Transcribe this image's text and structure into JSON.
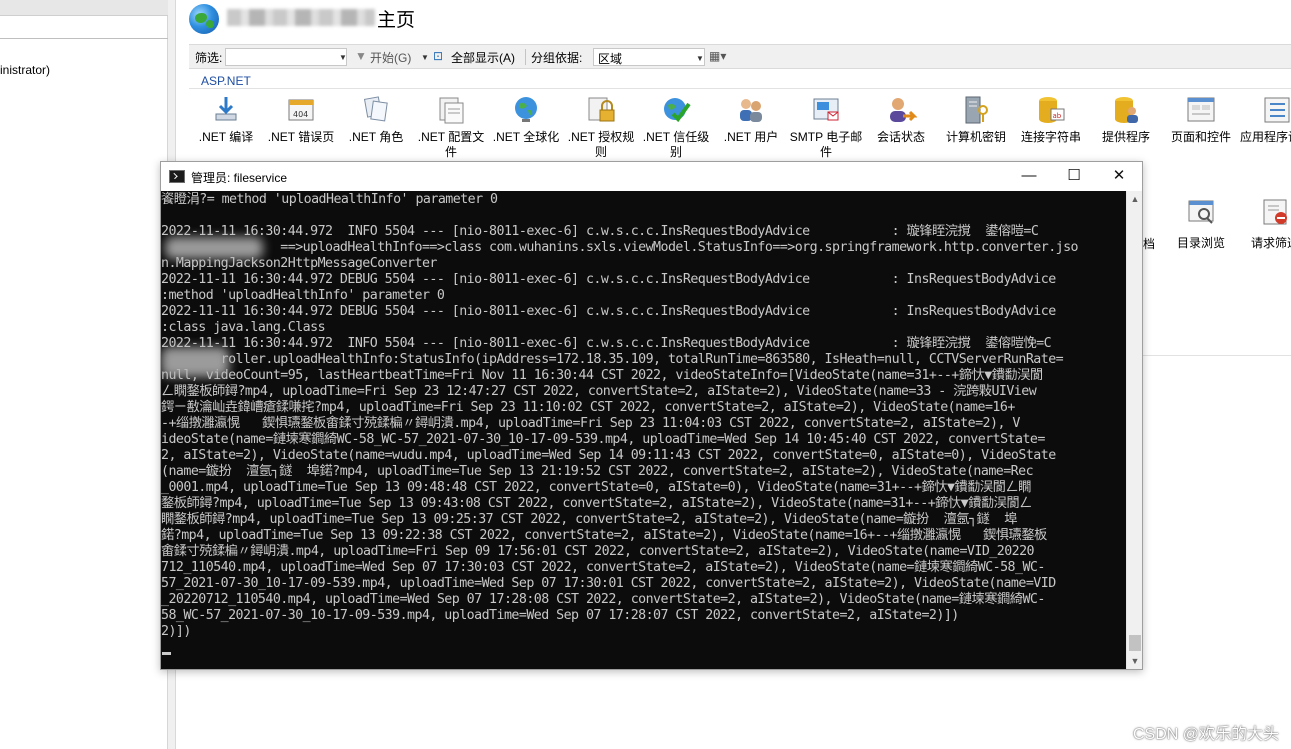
{
  "left_pane": {
    "admin_text": "inistrator)"
  },
  "iis": {
    "title": "主页",
    "filter": {
      "label": "筛选:",
      "start": "开始(G)",
      "show_all": "全部显示(A)",
      "group_by_label": "分组依据:",
      "group_by_value": "区域"
    },
    "section": "ASP.NET",
    "features": [
      {
        "label": ".NET 编译",
        "icon": "download-arrow-icon"
      },
      {
        "label": ".NET 错误页",
        "icon": "error-404-icon"
      },
      {
        "label": ".NET 角色",
        "icon": "roles-icon"
      },
      {
        "label": ".NET 配置文件",
        "icon": "profile-icon"
      },
      {
        "label": ".NET 全球化",
        "icon": "globe-icon"
      },
      {
        "label": ".NET 授权规则",
        "icon": "lock-icon"
      },
      {
        "label": ".NET 信任级别",
        "icon": "trust-check-icon"
      },
      {
        "label": ".NET 用户",
        "icon": "users-icon"
      },
      {
        "label": "SMTP 电子邮件",
        "icon": "smtp-icon"
      },
      {
        "label": "会话状态",
        "icon": "session-icon"
      },
      {
        "label": "计算机密钥",
        "icon": "machine-key-icon"
      },
      {
        "label": "连接字符串",
        "icon": "connection-string-icon"
      },
      {
        "label": "提供程序",
        "icon": "providers-icon"
      },
      {
        "label": "页面和控件",
        "icon": "pages-controls-icon"
      },
      {
        "label": "应用程序设置",
        "icon": "app-settings-icon"
      }
    ],
    "side_features": [
      {
        "label": "目录浏览",
        "icon": "directory-browse-icon"
      },
      {
        "label": "请求筛选",
        "icon": "request-filter-icon"
      }
    ],
    "partial_label": "档"
  },
  "console": {
    "title": "管理员:  fileservice",
    "controls": {
      "minimize": "—",
      "maximize": "☐",
      "close": "✕"
    },
    "lines": [
      "餈瞪涓?= method 'uploadHealthInfo' parameter 0",
      "",
      "2022-11-11 16:30:44.972  INFO 5504 --- [nio-8011-exec-6] c.w.s.c.c.InsRequestBodyAdvice           : 璇锋眰浣撹  鍙傛暟=C",
      "                ==>uploadHealthInfo==>class com.wuhanins.sxls.viewModel.StatusInfo==>org.springframework.http.converter.jso",
      "n.MappingJackson2HttpMessageConverter",
      "2022-11-11 16:30:44.972 DEBUG 5504 --- [nio-8011-exec-6] c.w.s.c.c.InsRequestBodyAdvice           : InsRequestBodyAdvice",
      ":method 'uploadHealthInfo' parameter 0",
      "2022-11-11 16:30:44.972 DEBUG 5504 --- [nio-8011-exec-6] c.w.s.c.c.InsRequestBodyAdvice           : InsRequestBodyAdvice",
      ":class java.lang.Class",
      "2022-11-11 16:30:44.972  INFO 5504 --- [nio-8011-exec-6] c.w.s.c.c.InsRequestBodyAdvice           : 璇锋眰浣撹  鍙傛暟悗=C",
      "        roller.uploadHealthInfo:StatusInfo(ipAddress=172.18.35.109, totalRunTime=863580, IsHeath=null, CCTVServerRunRate=",
      "null, videoCount=95, lastHeartbeatTime=Fri Nov 11 16:30:44 CST 2022, videoStateInfo=[VideoState(name=31+--+鍗忕▼鐨勫洖閬",
      "ㄥ瞯鍪板師鐞?mp4, uploadTime=Fri Sep 23 12:47:27 CST 2022, convertState=2, aIState=2), VideoState(name=33 - 浣跨敤UIView",
      "鍔ㄧ敾瀹屾垚鍏嶆瘡鍒嗛挓?mp4, uploadTime=Fri Sep 23 11:10:02 CST 2022, convertState=2, aIState=2), VideoState(name=16+",
      "-+缁撴灉瀛愰   鍥惧瓙鍪板畬鍒寸殑鍒楄〃鐞岄潰.mp4, uploadTime=Fri Sep 23 11:04:03 CST 2022, convertState=2, aIState=2), V",
      "ideoState(name=鏈堜寒鐧綺WC-58_WC-57_2021-07-30_10-17-09-539.mp4, uploadTime=Wed Sep 14 10:45:40 CST 2022, convertState=",
      "2, aIState=2), VideoState(name=wudu.mp4, uploadTime=Wed Sep 14 09:11:43 CST 2022, convertState=0, aIState=0), VideoState",
      "(name=鏇扮  澶氬┐鐩  埠鍩?mp4, uploadTime=Tue Sep 13 21:19:52 CST 2022, convertState=2, aIState=2), VideoState(name=Rec",
      "_0001.mp4, uploadTime=Tue Sep 13 09:48:48 CST 2022, convertState=0, aIState=0), VideoState(name=31+--+鍗忕▼鐨勫洖閬ㄥ瞯",
      "鍪板師鐞?mp4, uploadTime=Tue Sep 13 09:43:08 CST 2022, convertState=2, aIState=2), VideoState(name=31+--+鍗忕▼鐨勫洖閬ㄥ",
      "瞯鍪板師鐞?mp4, uploadTime=Tue Sep 13 09:25:37 CST 2022, convertState=2, aIState=2), VideoState(name=鏇扮  澶氬┐鐩  埠",
      "鍩?mp4, uploadTime=Tue Sep 13 09:22:38 CST 2022, convertState=2, aIState=2), VideoState(name=16+--+缁撴灉瀛愰   鍥惧瓙鍪板",
      "畬鍒寸殑鍒楄〃鐞岄潰.mp4, uploadTime=Fri Sep 09 17:56:01 CST 2022, convertState=2, aIState=2), VideoState(name=VID_20220",
      "712_110540.mp4, uploadTime=Wed Sep 07 17:30:03 CST 2022, convertState=2, aIState=2), VideoState(name=鏈堜寒鐧綺WC-58_WC-",
      "57_2021-07-30_10-17-09-539.mp4, uploadTime=Wed Sep 07 17:30:01 CST 2022, convertState=2, aIState=2), VideoState(name=VID",
      "_20220712_110540.mp4, uploadTime=Wed Sep 07 17:28:08 CST 2022, convertState=2, aIState=2), VideoState(name=鏈堜寒鐧綺WC-",
      "58_WC-57_2021-07-30_10-17-09-539.mp4, uploadTime=Wed Sep 07 17:28:07 CST 2022, convertState=2, aIState=2)])",
      "2)])"
    ]
  },
  "watermark": "CSDN @欢乐的大头"
}
